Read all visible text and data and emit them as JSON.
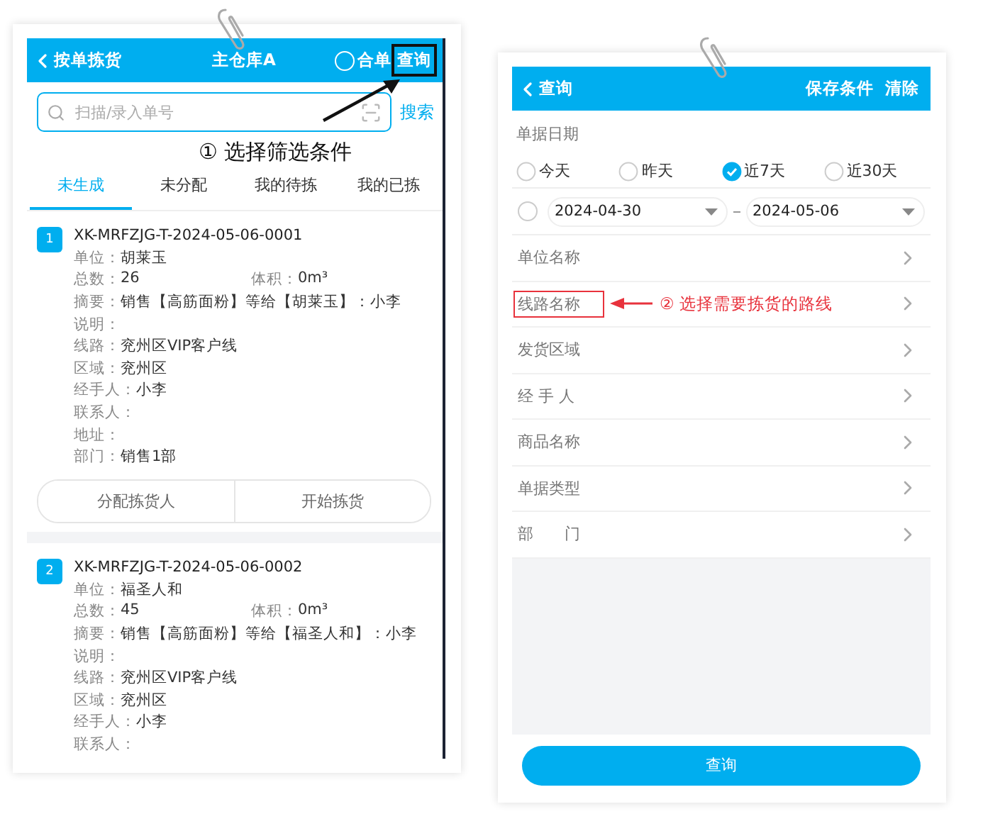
{
  "left_screen": {
    "header": {
      "back_label": "按单拣货",
      "title": "主仓库A",
      "merge_option": {
        "label": "合单",
        "checked": false
      },
      "query_button": {
        "label": "查询",
        "highlighted": true,
        "note": "① 选择筛选条件"
      }
    },
    "search": {
      "placeholder": "扫描/录入单号",
      "button": "搜索"
    },
    "tabs": [
      {
        "label": "未生成",
        "selected": true
      },
      {
        "label": "未分配",
        "selected": false
      },
      {
        "label": "我的待拣",
        "selected": false
      },
      {
        "label": "我的已拣",
        "selected": false
      }
    ],
    "orders": [
      {
        "index": "1",
        "number": "XK-MRFZJG-T-2024-05-06-0001",
        "rows": [
          {
            "cells": [
              {
                "label": "单位：",
                "value": "胡莱玉"
              }
            ]
          },
          {
            "cells": [
              {
                "label": "总数：",
                "value": "26"
              },
              {
                "label": "体积：",
                "value": "0m³"
              }
            ]
          },
          {
            "cells": [
              {
                "label": "摘要：",
                "value": "销售【高筋面粉】等给【胡莱玉】：小李"
              }
            ]
          },
          {
            "cells": [
              {
                "label": "说明："
              }
            ]
          },
          {
            "cells": [
              {
                "label": "线路：",
                "value": "兖州区VIP客户线"
              }
            ]
          },
          {
            "cells": [
              {
                "label": "区域：",
                "value": "兖州区"
              }
            ]
          },
          {
            "cells": [
              {
                "label": "经手人：",
                "value": "小李"
              }
            ]
          },
          {
            "cells": [
              {
                "label": "联系人："
              }
            ]
          },
          {
            "cells": [
              {
                "label": "地址："
              }
            ]
          },
          {
            "cells": [
              {
                "label": "部门：",
                "value": "销售1部"
              }
            ]
          }
        ],
        "actions": [
          "分配拣货人",
          "开始拣货"
        ]
      },
      {
        "index": "2",
        "number": "XK-MRFZJG-T-2024-05-06-0002",
        "rows": [
          {
            "cells": [
              {
                "label": "单位：",
                "value": "福圣人和"
              }
            ]
          },
          {
            "cells": [
              {
                "label": "总数：",
                "value": "45"
              },
              {
                "label": "体积：",
                "value": "0m³"
              }
            ]
          },
          {
            "cells": [
              {
                "label": "摘要：",
                "value": "销售【高筋面粉】等给【福圣人和】：小李"
              }
            ]
          },
          {
            "cells": [
              {
                "label": "说明："
              }
            ]
          },
          {
            "cells": [
              {
                "label": "线路：",
                "value": "兖州区VIP客户线"
              }
            ]
          },
          {
            "cells": [
              {
                "label": "区域：",
                "value": "兖州区"
              }
            ]
          },
          {
            "cells": [
              {
                "label": "经手人：",
                "value": "小李"
              }
            ]
          },
          {
            "cells": [
              {
                "label": "联系人："
              }
            ]
          }
        ]
      }
    ]
  },
  "right_screen": {
    "header": {
      "back_label": "查询",
      "actions": [
        "保存条件",
        "清除"
      ]
    },
    "date_section": {
      "title": "单据日期",
      "options": [
        {
          "label": "今天",
          "selected": false
        },
        {
          "label": "昨天",
          "selected": false
        },
        {
          "label": "近7天",
          "selected": true
        },
        {
          "label": "近30天",
          "selected": false
        }
      ],
      "custom_range": {
        "checked": false,
        "from": "2024-04-30",
        "to": "2024-05-06"
      }
    },
    "filters": [
      {
        "label": "单位名称",
        "highlighted": false
      },
      {
        "label": "线路名称",
        "highlighted": true,
        "note": "② 选择需要拣货的路线"
      },
      {
        "label": "发货区域",
        "highlighted": false
      },
      {
        "label": "经 手 人",
        "highlighted": false
      },
      {
        "label": "商品名称",
        "highlighted": false
      },
      {
        "label": "单据类型",
        "highlighted": false
      },
      {
        "label": "部　　门",
        "highlighted": false
      }
    ],
    "submit_button": "查询"
  }
}
